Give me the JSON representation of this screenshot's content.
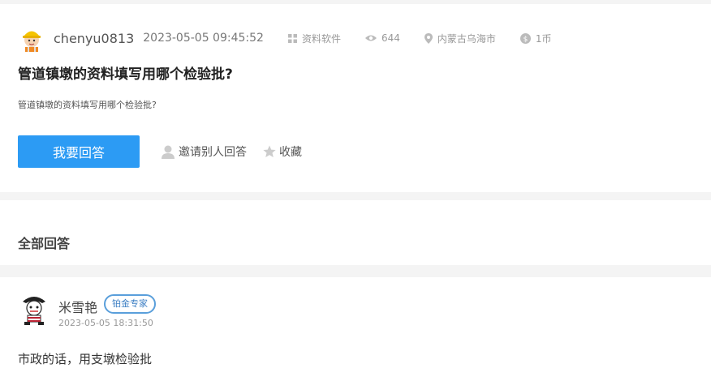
{
  "question": {
    "user": {
      "name": "chenyu0813",
      "avatar_icon": "worker-avatar-icon"
    },
    "time": "2023-05-05 09:45:52",
    "category": {
      "icon": "grid-icon",
      "label": "资料软件"
    },
    "views": {
      "icon": "eye-icon",
      "count": "644"
    },
    "location": {
      "icon": "location-pin-icon",
      "label": "内蒙古乌海市"
    },
    "reward": {
      "icon": "coin-icon",
      "label": "1币"
    },
    "title": "管道镇墩的资料填写用哪个检验批?",
    "body": "管道镇墩的资料填写用哪个检验批?",
    "actions": {
      "answer_label": "我要回答",
      "invite_label": "邀请别人回答",
      "collect_label": "收藏"
    },
    "colors": {
      "primary": "#2c9bf4",
      "badge": "#5a9fdb"
    }
  },
  "answers_section": {
    "title": "全部回答"
  },
  "answers": [
    {
      "user": {
        "name": "米雪艳",
        "avatar_icon": "cartoon-avatar-icon"
      },
      "badge": "铂金专家",
      "time": "2023-05-05 18:31:50",
      "content": "市政的话，用支墩检验批"
    }
  ]
}
